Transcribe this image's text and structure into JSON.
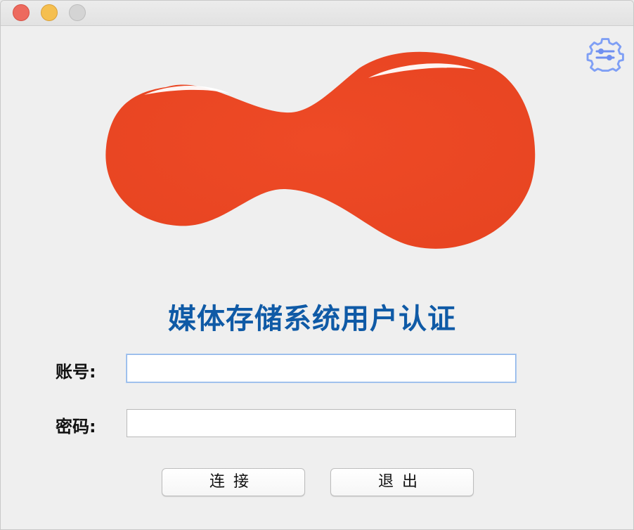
{
  "window": {
    "controls": {
      "close_icon": "close-circle-icon",
      "minimize_icon": "minimize-circle-icon",
      "zoom_icon": "zoom-circle-icon"
    }
  },
  "toolbar": {
    "settings_icon": "settings-gear-sliders-icon"
  },
  "logo": {
    "icon": "red-blob-logo",
    "color": "#ee4a26"
  },
  "header": {
    "title": "媒体存储系统用户认证",
    "title_color": "#0f5aa6"
  },
  "form": {
    "account_label": "账号:",
    "account_value": "",
    "password_label": "密码:",
    "password_value": ""
  },
  "actions": {
    "connect_label": "连接",
    "exit_label": "退出"
  }
}
